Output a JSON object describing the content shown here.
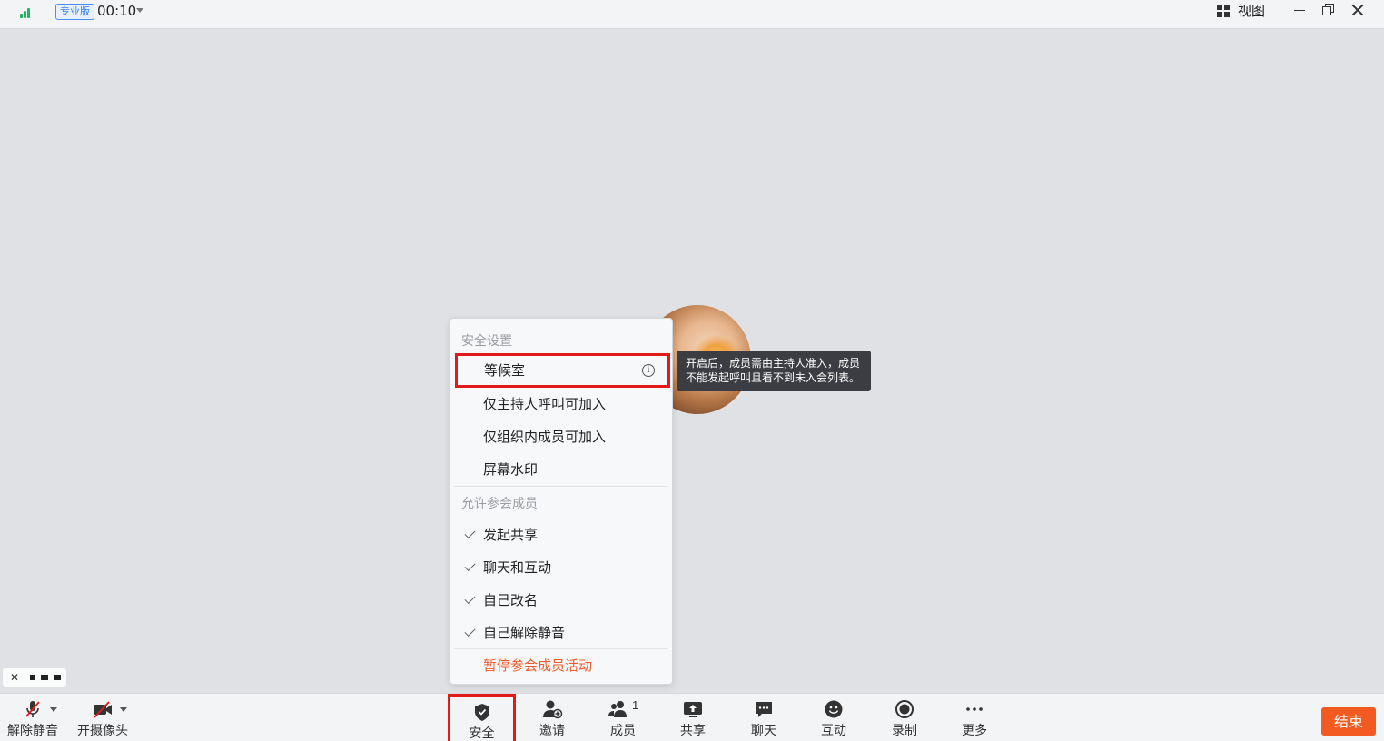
{
  "titlebar": {
    "edition_badge": "专业版",
    "timer": "00:10",
    "view_label": "视图"
  },
  "security_menu": {
    "section_security": "安全设置",
    "items_security": [
      {
        "label": "等候室",
        "has_info": true
      },
      {
        "label": "仅主持人呼叫可加入"
      },
      {
        "label": "仅组织内成员可加入"
      },
      {
        "label": "屏幕水印"
      }
    ],
    "section_allow": "允许参会成员",
    "items_allow": [
      {
        "label": "发起共享",
        "checked": true
      },
      {
        "label": "聊天和互动",
        "checked": true
      },
      {
        "label": "自己改名",
        "checked": true
      },
      {
        "label": "自己解除静音",
        "checked": true
      }
    ],
    "pause_label": "暂停参会成员活动"
  },
  "tooltip": {
    "line1": "开启后，成员需由主持人准入，成员",
    "line2": "不能发起呼叫且看不到未入会列表。"
  },
  "toolbar": {
    "unmute": "解除静音",
    "camera": "开摄像头",
    "security": "安全",
    "invite": "邀请",
    "members": "成员",
    "member_count": "1",
    "share": "共享",
    "chat": "聊天",
    "interact": "互动",
    "record": "录制",
    "more": "更多",
    "end": "结束"
  },
  "colors": {
    "accent_red": "#e11a1a",
    "end_button": "#f25a22",
    "danger_text": "#ef5a2a",
    "signal_green": "#22b35e",
    "badge_blue": "#2f7cf6"
  }
}
